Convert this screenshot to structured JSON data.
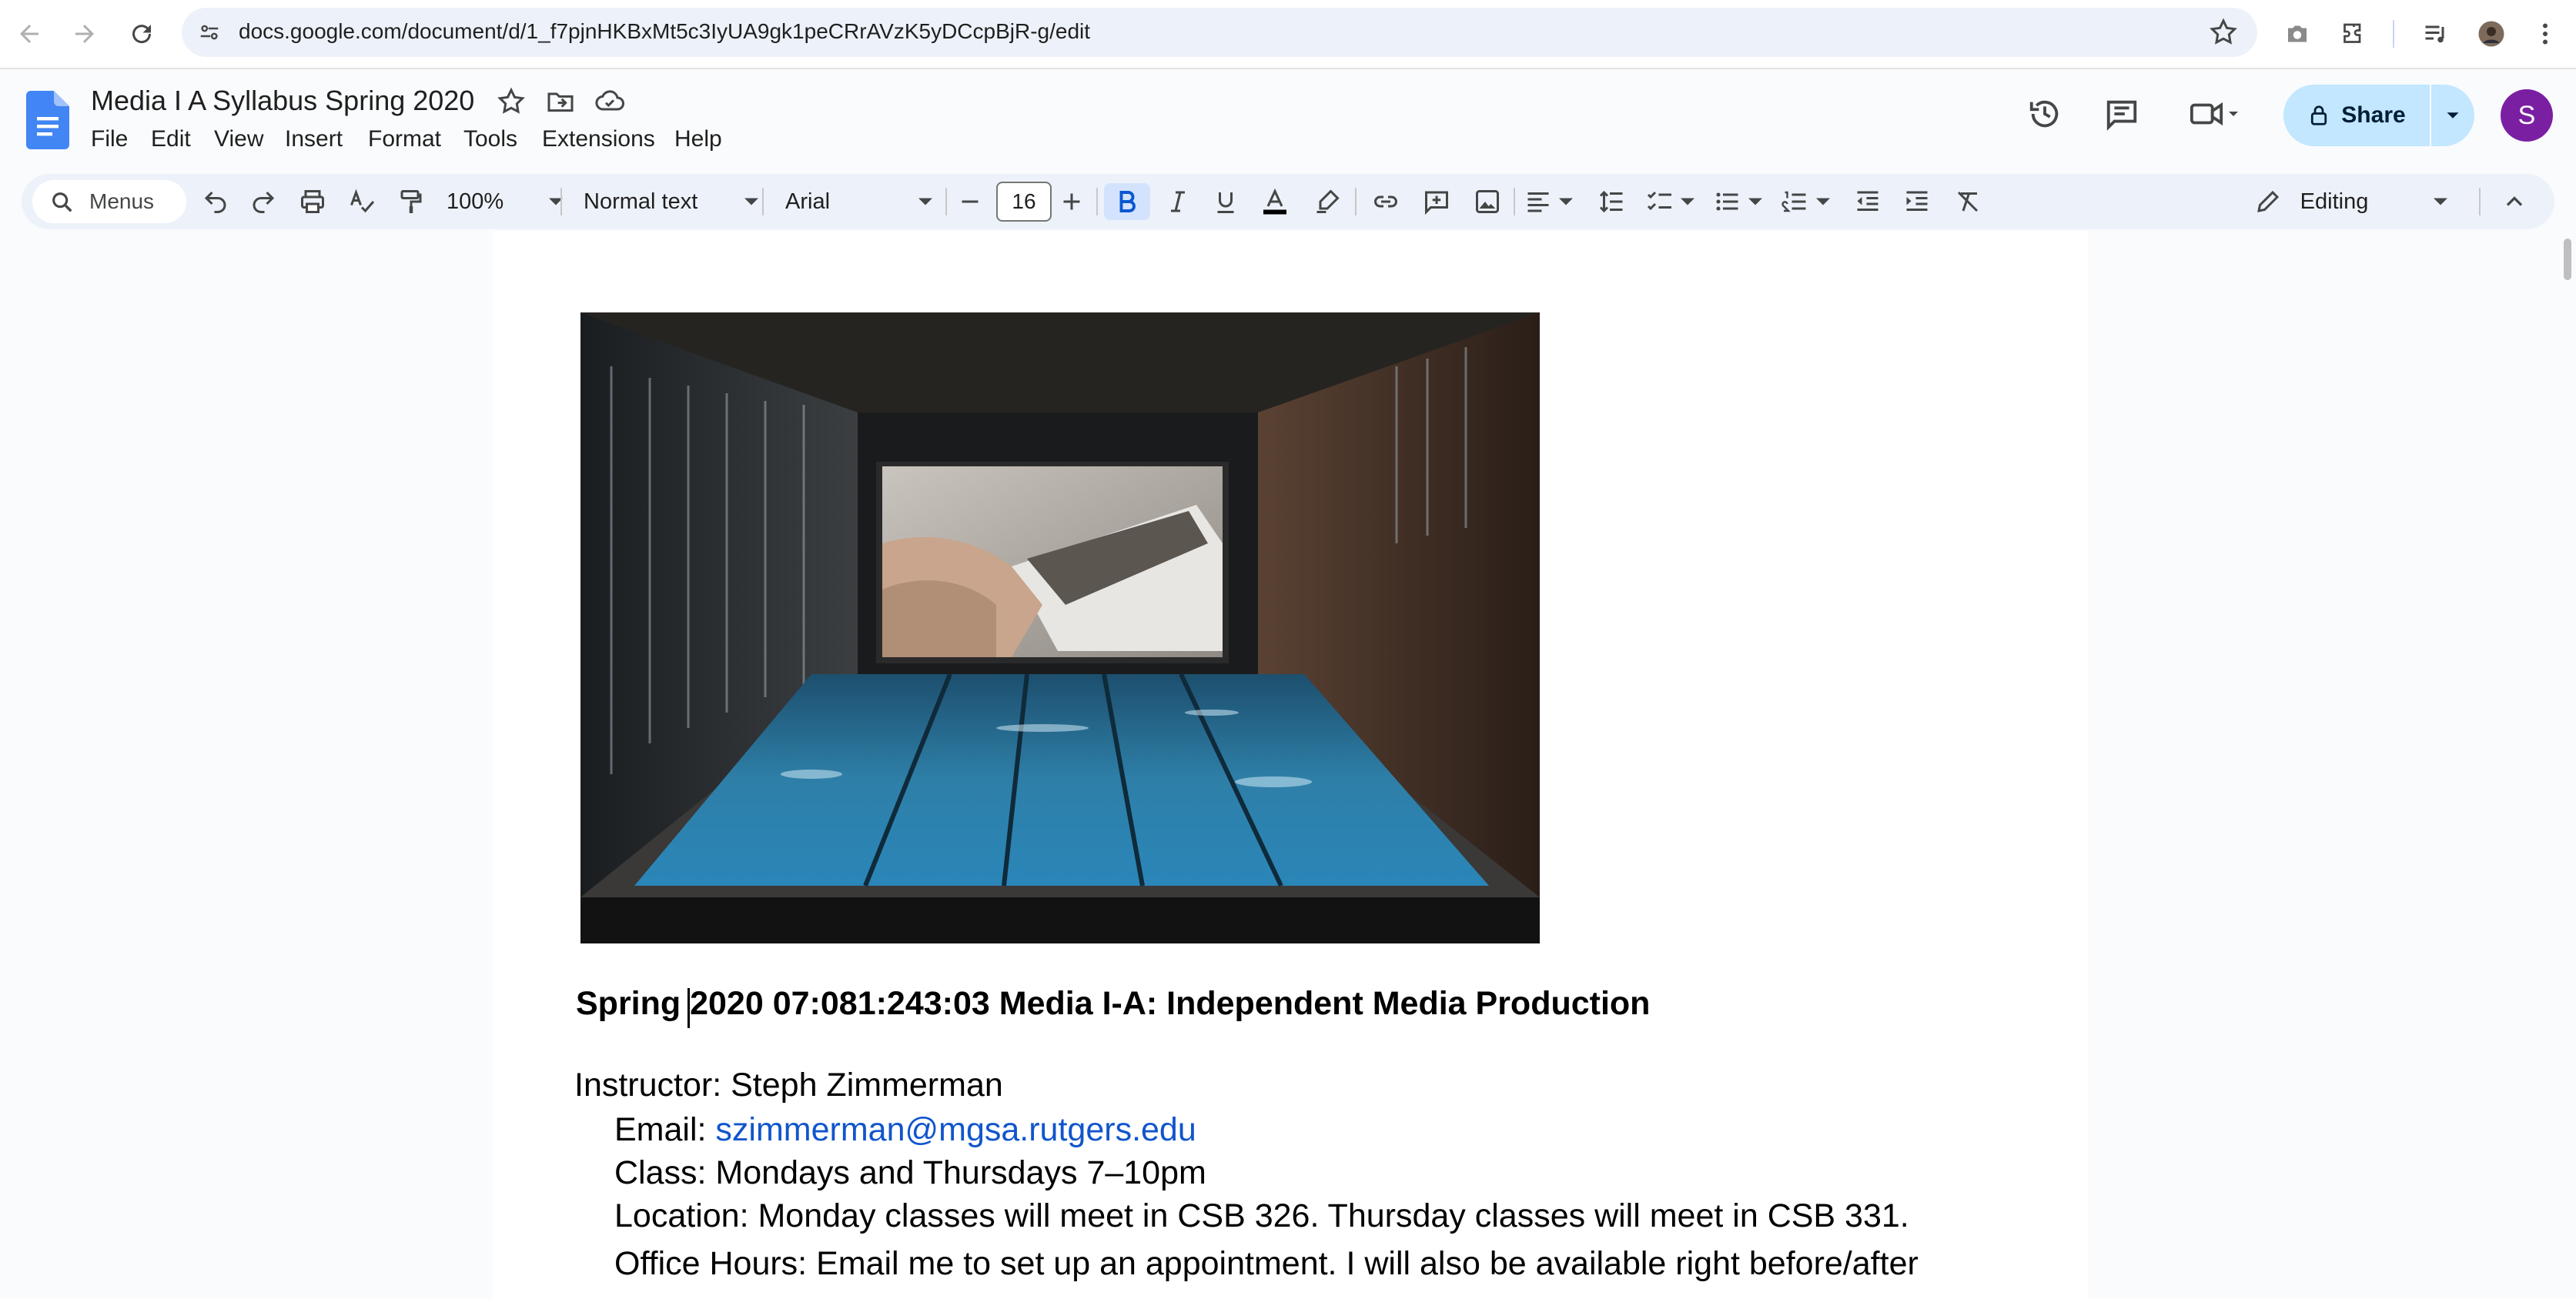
{
  "browser": {
    "url": "docs.google.com/document/d/1_f7pjnHKBxMt5c3IyUA9gk1peCRrAVzK5yDCcpBjR-g/edit"
  },
  "doc": {
    "title": "Media I A Syllabus Spring 2020"
  },
  "menu": {
    "items": [
      "File",
      "Edit",
      "View",
      "Insert",
      "Format",
      "Tools",
      "Extensions",
      "Help"
    ]
  },
  "header": {
    "share_label": "Share",
    "avatar_initial": "S"
  },
  "toolbar": {
    "search_label": "Menus",
    "zoom": "100%",
    "style": "Normal text",
    "font": "Arial",
    "font_size": "16",
    "mode": "Editing"
  },
  "content": {
    "heading": "Spring 2020 07:081:243:03 Media I-A: Independent Media Production",
    "instructor": "Instructor: Steph Zimmerman",
    "email_label": "Email: ",
    "email": "szimmerman@mgsa.rutgers.edu",
    "class": "Class: Mondays and Thursdays 7–10pm",
    "location": "Location: Monday classes will meet in CSB 326. Thursday classes will meet in CSB 331.",
    "office_hours": "Office Hours: Email me to set up an appointment. I will also be available right before/after"
  },
  "colors": {
    "share_bg": "#c2e7ff",
    "link": "#1155cc",
    "avatar": "#7b1fa2",
    "bold_active": "#d3e3fd"
  }
}
